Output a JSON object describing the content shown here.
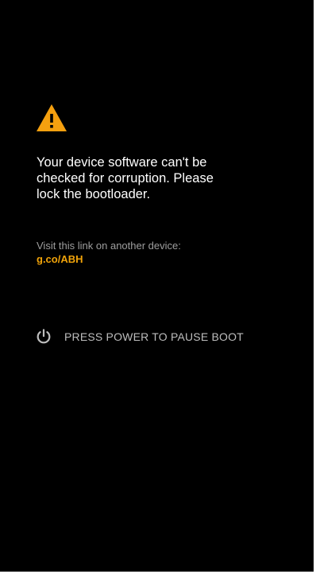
{
  "warning": {
    "icon": "warning-triangle-icon",
    "color": "#f5a00f"
  },
  "message": {
    "lines": [
      "Your device software can't be",
      "checked for corruption. Please",
      "lock the bootloader."
    ]
  },
  "visit": {
    "label": "Visit this link on another device:",
    "link": "g.co/ABH",
    "link_color": "#f0a30a"
  },
  "power": {
    "icon": "power-icon",
    "label": "PRESS POWER TO PAUSE BOOT"
  },
  "colors": {
    "background": "#000000",
    "text": "#ffffff",
    "muted_text": "#9e9e9e"
  }
}
